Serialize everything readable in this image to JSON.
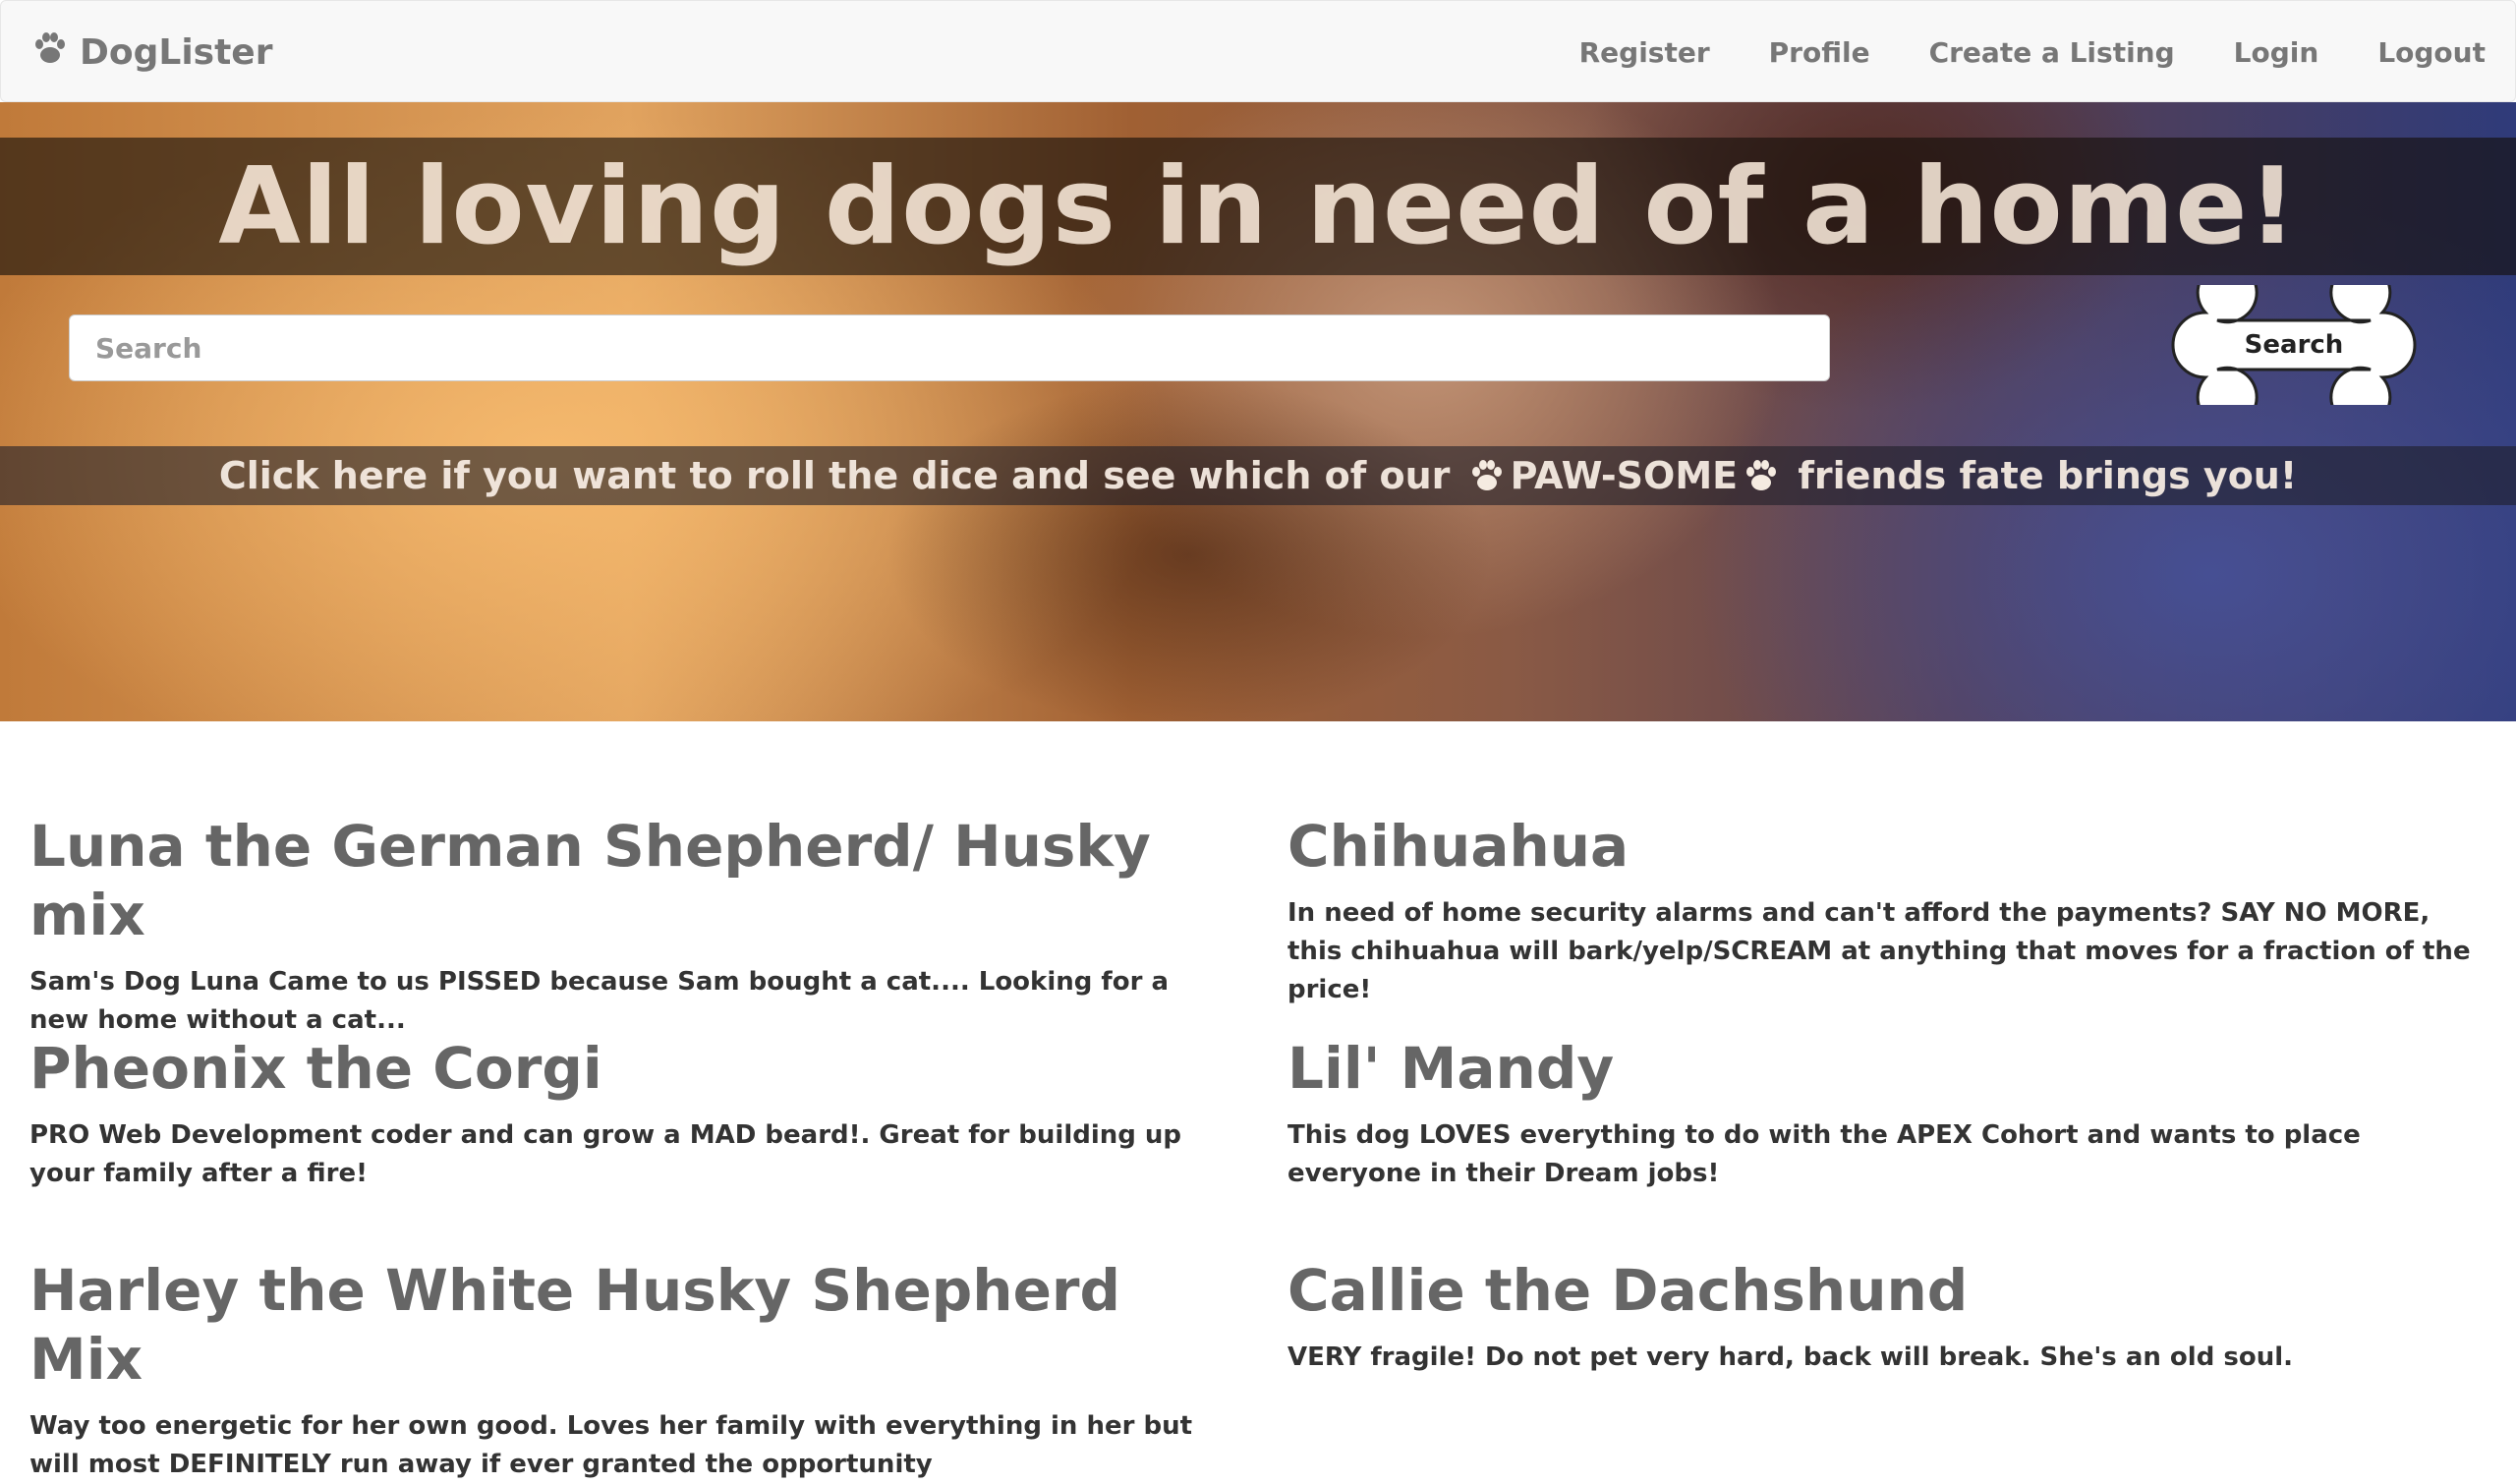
{
  "navbar": {
    "brand": "DogLister",
    "brand_icon": "paw-icon",
    "links": [
      "Register",
      "Profile",
      "Create a Listing",
      "Login",
      "Logout"
    ]
  },
  "hero": {
    "title": "All loving dogs in need of a home!",
    "search": {
      "placeholder": "Search",
      "value": ""
    },
    "search_button": "Search",
    "dice_link": {
      "before": "Click here if you want to roll the dice and see which of our ",
      "highlight": "PAW-SOME",
      "after": " friends fate brings you!",
      "icon": "paw-icon"
    }
  },
  "listings": [
    {
      "title": "Luna the German Shepherd/ Husky mix",
      "description": "Sam's Dog Luna Came to us PISSED because Sam bought a cat.... Looking for a new home without a cat..."
    },
    {
      "title": "Chihuahua",
      "description": "In need of home security alarms and can't afford the payments? SAY NO MORE, this chihuahua will bark/yelp/SCREAM at anything that moves for a fraction of the price!"
    },
    {
      "title": "Pheonix the Corgi",
      "description": "PRO Web Development coder and can grow a MAD beard!. Great for building up your family after a fire!"
    },
    {
      "title": "Lil' Mandy",
      "description": "This dog LOVES everything to do with the APEX Cohort and wants to place everyone in their Dream jobs!"
    },
    {
      "title": "Harley the White Husky Shepherd Mix",
      "description": "Way too energetic for her own good. Loves her family with everything in her but will most DEFINITELY run away if ever granted the opportunity"
    },
    {
      "title": "Callie the Dachshund",
      "description": "VERY fragile! Do not pet very hard, back will break. She's an old soul."
    }
  ]
}
